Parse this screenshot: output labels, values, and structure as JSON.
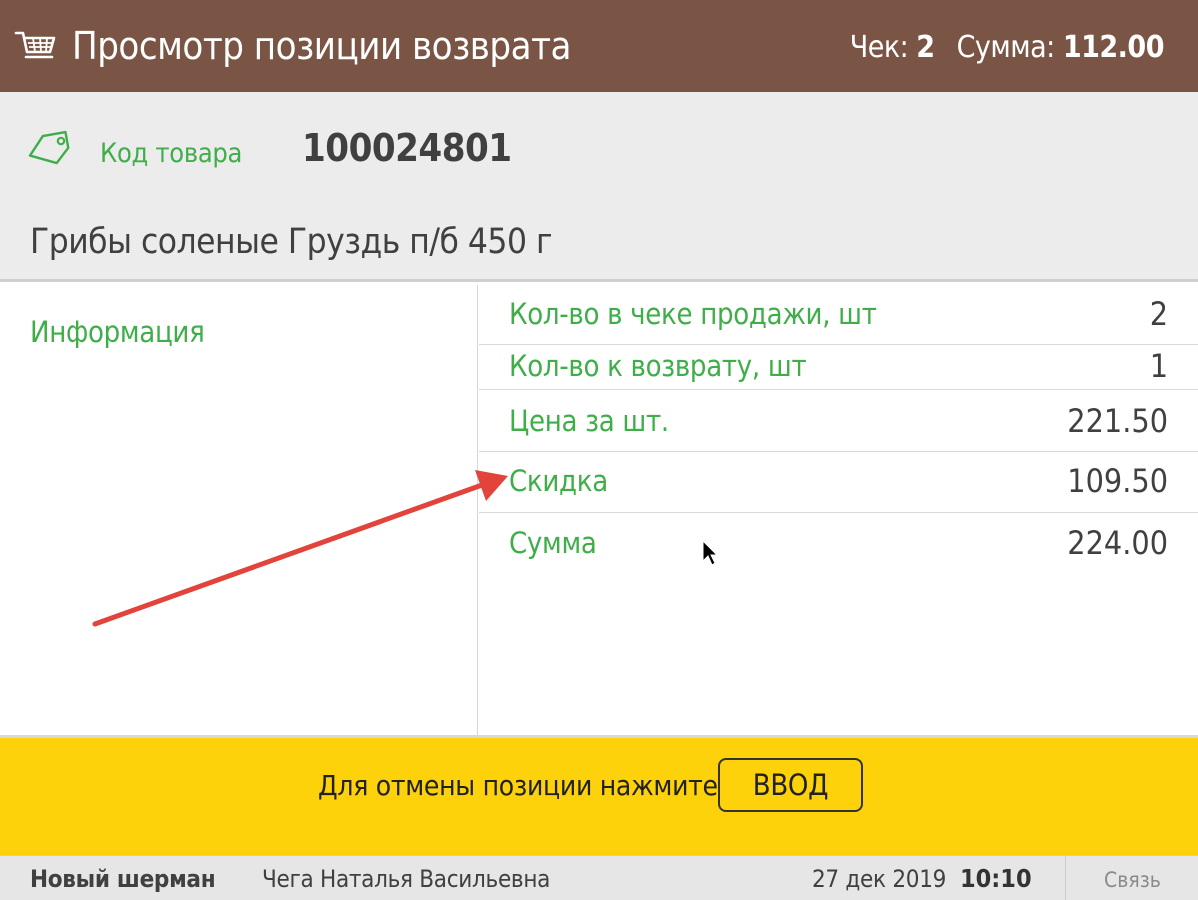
{
  "header": {
    "icon": "cart-icon",
    "title": "Просмотр позиции возврата",
    "check_label": "Чек:",
    "check_value": "2",
    "sum_label": "Сумма:",
    "sum_value": "112.00"
  },
  "product": {
    "icon": "tag-icon",
    "code_label": "Код товара",
    "code_value": "100024801",
    "name": "Грибы соленые Груздь п/б 450 г"
  },
  "info": {
    "title": "Информация",
    "rows": [
      {
        "label": "Кол-во в чеке продажи, шт",
        "value": "2"
      },
      {
        "label": "Кол-во к возврату, шт",
        "value": "1"
      },
      {
        "label": "Цена за шт.",
        "value": "221.50"
      },
      {
        "label": "Скидка",
        "value": "109.50"
      },
      {
        "label": "Сумма",
        "value": "224.00"
      }
    ]
  },
  "action": {
    "text": "Для отмены позиции нажмите",
    "button_label": "ВВОД"
  },
  "status": {
    "shop": "Новый шерман",
    "user": "Чега Наталья Васильевна",
    "date": "27 дек 2019",
    "time": "10:10",
    "link": "Связь"
  },
  "colors": {
    "header_bg": "#7a5444",
    "accent_green": "#3fae49",
    "action_bar": "#fdd20b",
    "annotation_arrow": "#e2433a"
  }
}
